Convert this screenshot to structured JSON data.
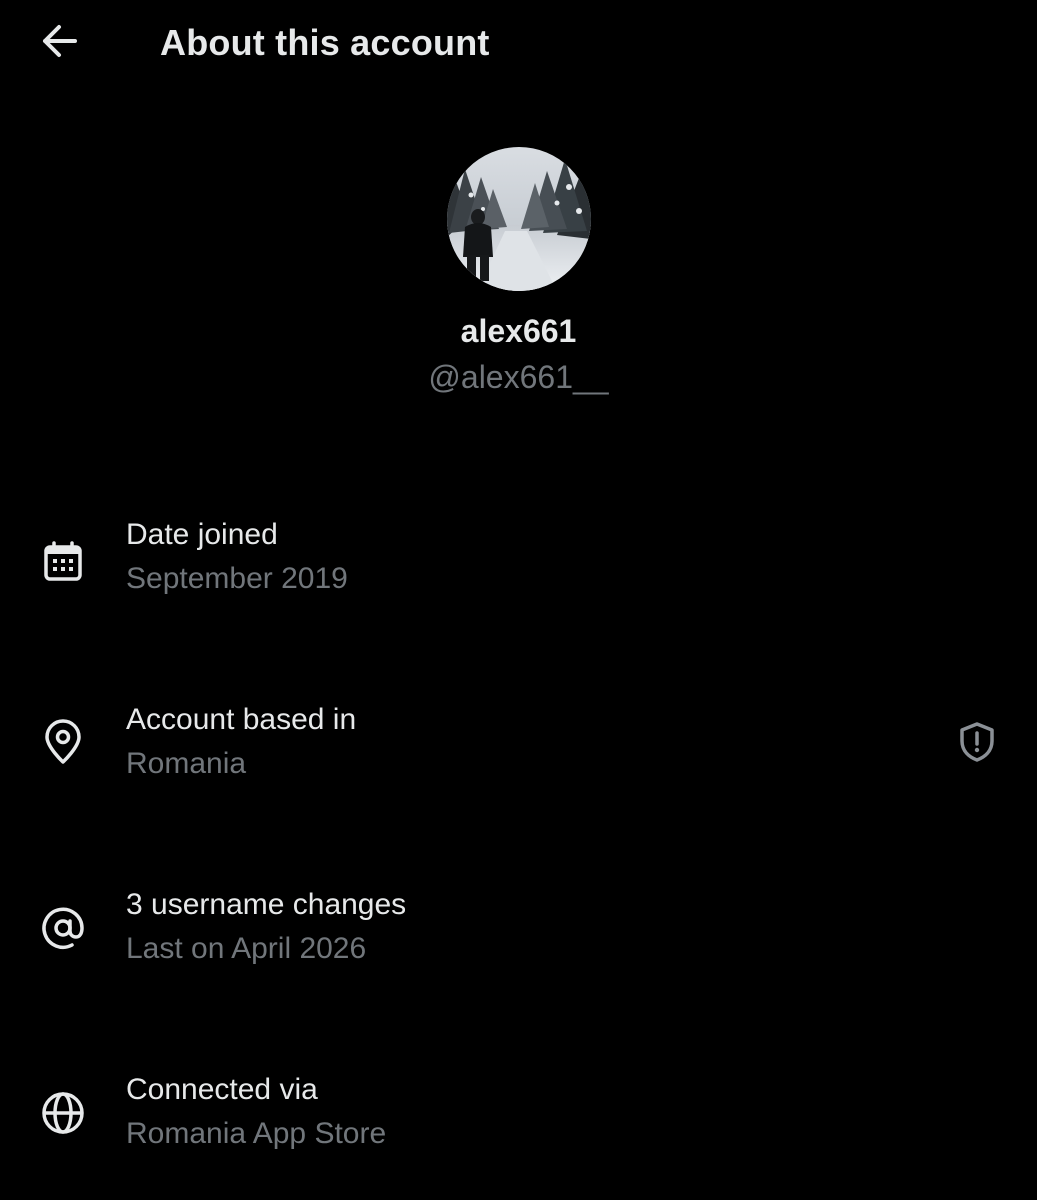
{
  "header": {
    "title": "About this account",
    "back_icon": "arrow-left-icon"
  },
  "profile": {
    "display_name": "alex661",
    "handle": "@alex661__"
  },
  "rows": [
    {
      "icon": "calendar-icon",
      "title": "Date joined",
      "value": "September 2019"
    },
    {
      "icon": "location-pin-icon",
      "title": "Account based in",
      "value": "Romania",
      "trailing_icon": "shield-alert-icon"
    },
    {
      "icon": "at-sign-icon",
      "title": "3 username changes",
      "value": "Last on April 2026"
    },
    {
      "icon": "globe-icon",
      "title": "Connected via",
      "value": "Romania App Store"
    }
  ],
  "colors": {
    "background": "#000000",
    "primary_text": "#e7e9ea",
    "secondary_text": "#71767b"
  }
}
